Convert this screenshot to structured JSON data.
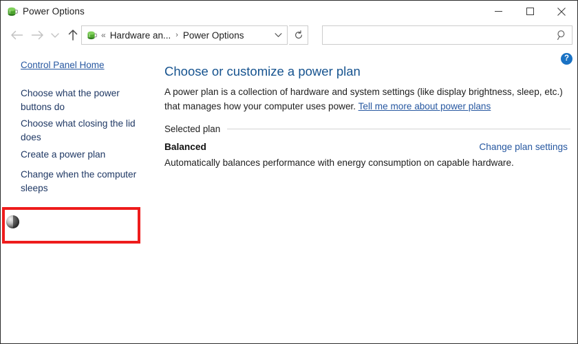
{
  "window": {
    "title": "Power Options",
    "app_icon": "power-plug-icon",
    "controls": {
      "minimize": "minimize-icon",
      "maximize": "maximize-icon",
      "close": "close-icon"
    }
  },
  "navbar": {
    "back": "back-arrow-icon",
    "forward": "forward-arrow-icon",
    "recent": "chevron-down-icon",
    "up": "up-arrow-icon",
    "breadcrumb": {
      "icon": "power-plug-icon",
      "overflow": "«",
      "separator": "›",
      "items": [
        "Hardware an...",
        "Power Options"
      ],
      "caret": "chevron-down-icon"
    },
    "refresh": "refresh-icon",
    "search": {
      "value": "",
      "placeholder": "",
      "icon": "search-icon"
    }
  },
  "sidebar": {
    "home_link": "Control Panel Home",
    "items": [
      "Choose what the power buttons do",
      "Choose what closing the lid does",
      "Create a power plan",
      "Change when the computer sleeps"
    ],
    "highlight": {
      "target": "Change when the computer sleeps",
      "color": "#ee1c1c"
    },
    "cursor": "busy-cursor"
  },
  "main": {
    "help_label": "?",
    "title": "Choose or customize a power plan",
    "description_before": "A power plan is a collection of hardware and system settings (like display brightness, sleep, etc.) that manages how your computer uses power. ",
    "description_link": "Tell me more about power plans",
    "group_label": "Selected plan",
    "plan_name": "Balanced",
    "plan_settings_link": "Change plan settings",
    "plan_description": "Automatically balances performance with energy consumption on capable hardware."
  },
  "colors": {
    "link_blue": "#2657a0",
    "heading_blue": "#16538f",
    "sidebar_link": "#1f3864",
    "highlight_red": "#ee1c1c",
    "help_blue": "#1a72c4"
  }
}
